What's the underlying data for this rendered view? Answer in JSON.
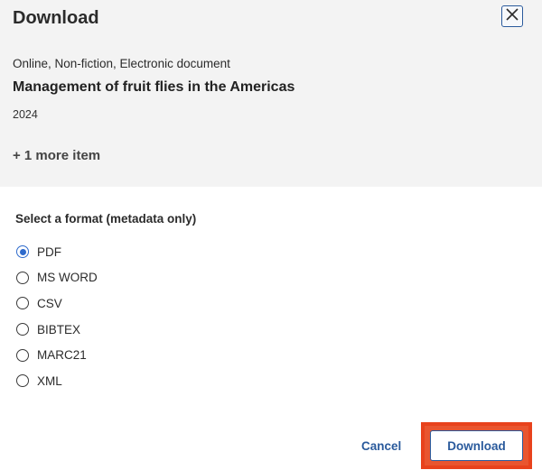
{
  "dialog": {
    "title": "Download",
    "close_icon": "close-icon"
  },
  "item": {
    "type": "Online, Non-fiction, Electronic document",
    "title": "Management of fruit flies in the Americas",
    "year": "2024",
    "more": "+ 1 more item"
  },
  "format": {
    "label": "Select a format (metadata only)",
    "selected": "PDF",
    "options": [
      {
        "label": "PDF",
        "checked": true
      },
      {
        "label": "MS WORD",
        "checked": false
      },
      {
        "label": "CSV",
        "checked": false
      },
      {
        "label": "BIBTEX",
        "checked": false
      },
      {
        "label": "MARC21",
        "checked": false
      },
      {
        "label": "XML",
        "checked": false
      }
    ]
  },
  "actions": {
    "cancel": "Cancel",
    "download": "Download"
  },
  "colors": {
    "accent": "#2f6bcc",
    "link": "#2a5a9c",
    "highlight": "#e8421c"
  }
}
